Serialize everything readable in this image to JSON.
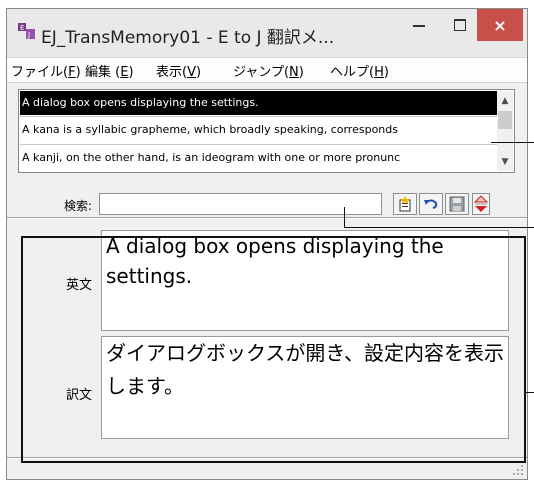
{
  "window": {
    "title": "EJ_TransMemory01 - E to J 翻訳メ...",
    "close_label": "×"
  },
  "menu": [
    {
      "label": "ファイル(",
      "key": "F",
      "tail": ")"
    },
    {
      "label": "編集 (",
      "key": "E",
      "tail": ")"
    },
    {
      "label": "表示(",
      "key": "V",
      "tail": ")"
    },
    {
      "label": "ジャンプ(",
      "key": "N",
      "tail": ")"
    },
    {
      "label": "ヘルプ(",
      "key": "H",
      "tail": ")"
    }
  ],
  "list": {
    "items": [
      {
        "text": "A dialog box opens displaying the settings.",
        "selected": true
      },
      {
        "text": "A kana is a syllabic grapheme, which broadly speaking, corresponds",
        "selected": false
      },
      {
        "text": "A kanji, on the other hand, is an ideogram with one or more pronunc",
        "selected": false
      }
    ]
  },
  "search": {
    "label": "検索:",
    "value": "",
    "buttons": [
      "add-entry-icon",
      "undo-icon",
      "save-icon",
      "up-down-arrows-icon"
    ]
  },
  "fields": {
    "english_label": "英文",
    "english_text": "A dialog box opens displaying the settings.",
    "japanese_label": "訳文",
    "japanese_text": "ダイアログボックスが開き、設定内容を表示します。"
  },
  "colors": {
    "selection": "#000000",
    "close_button": "#c7514a",
    "arrow_red": "#d42020"
  }
}
